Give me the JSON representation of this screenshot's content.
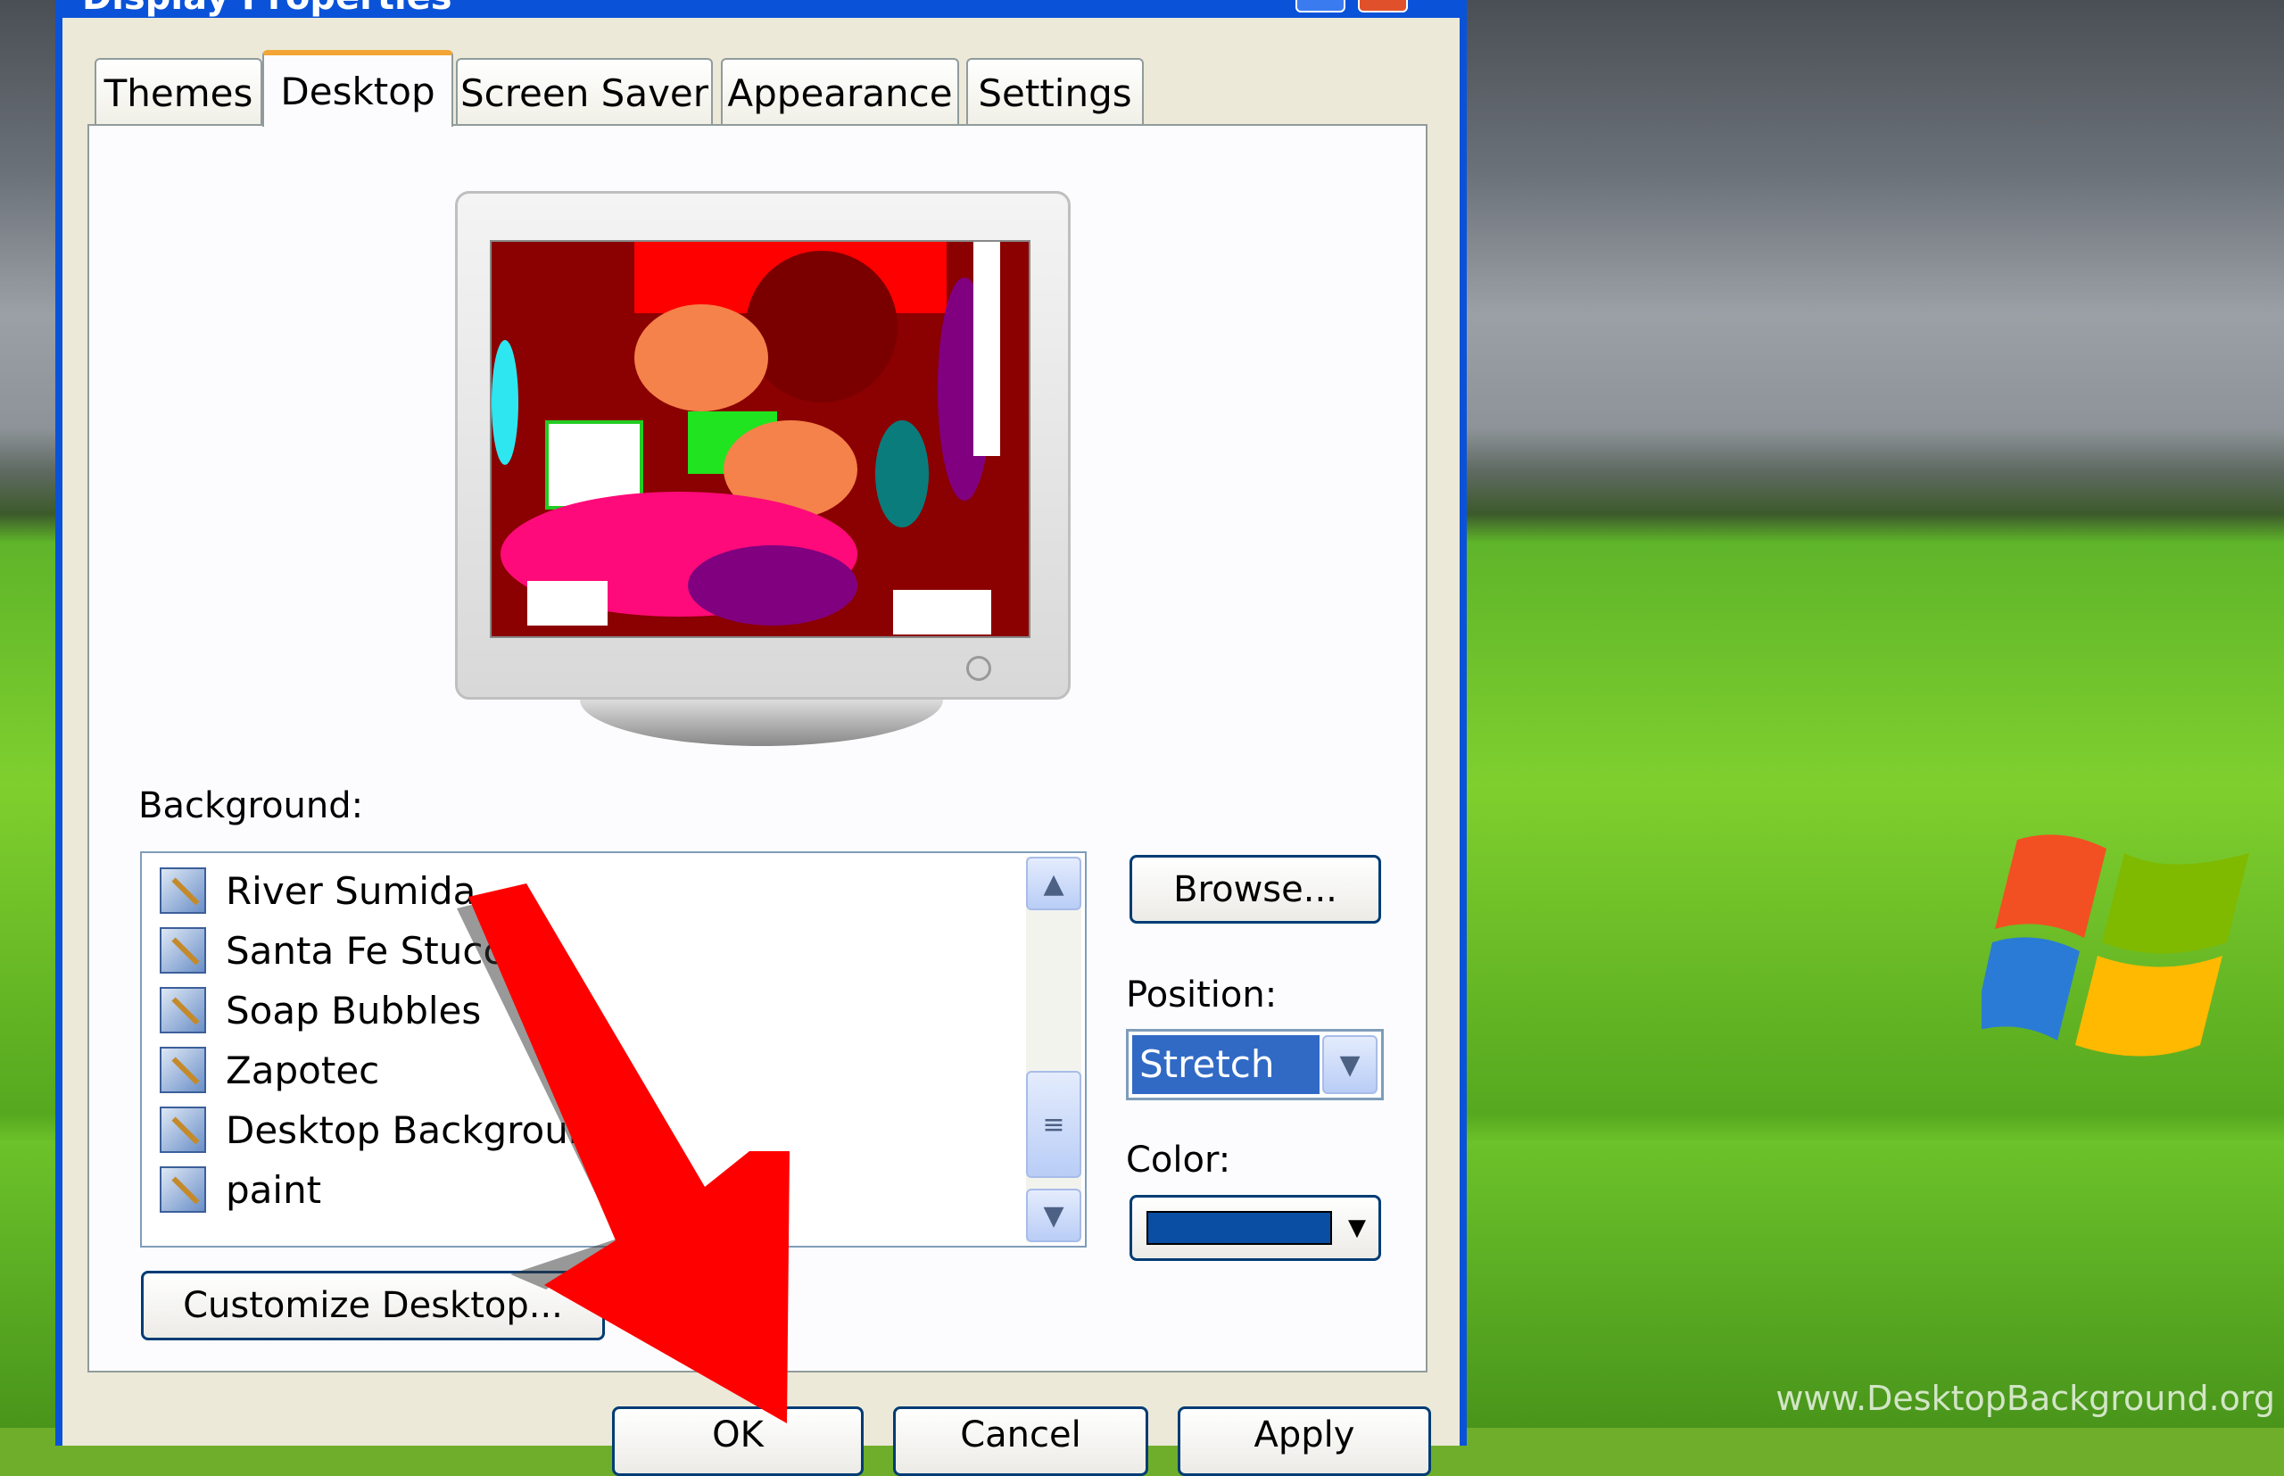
{
  "window": {
    "title": "Display Properties"
  },
  "tabs": [
    {
      "label": "Themes"
    },
    {
      "label": "Desktop"
    },
    {
      "label": "Screen Saver"
    },
    {
      "label": "Appearance"
    },
    {
      "label": "Settings"
    }
  ],
  "active_tab": "Desktop",
  "background": {
    "label": "Background:",
    "items": [
      "River Sumida",
      "Santa Fe Stucco",
      "Soap Bubbles",
      "Zapotec",
      "Desktop Background",
      "paint"
    ]
  },
  "browse_label": "Browse...",
  "position": {
    "label": "Position:",
    "value": "Stretch"
  },
  "color": {
    "label": "Color:",
    "value": "#0a4ea3"
  },
  "customize_label": "Customize Desktop...",
  "footer": {
    "ok": "OK",
    "cancel": "Cancel",
    "apply": "Apply"
  },
  "watermark": "www.DesktopBackground.org",
  "annotation": {
    "arrow_color": "#ff0000"
  }
}
